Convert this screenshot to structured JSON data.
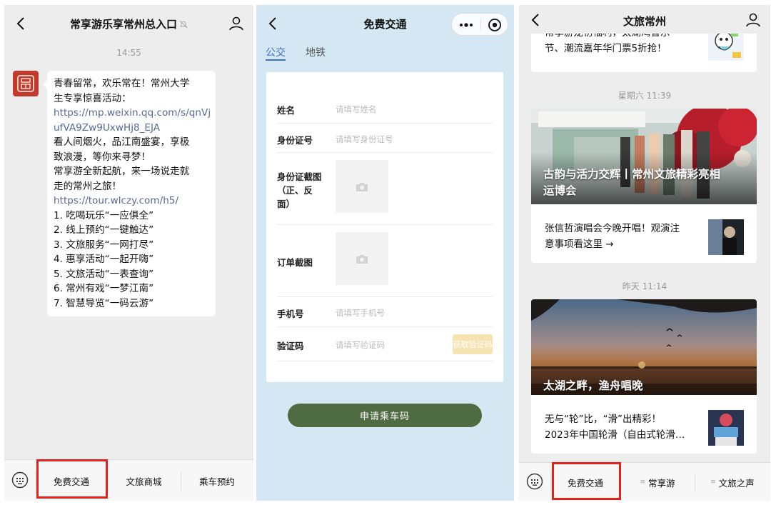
{
  "chat": {
    "title": "常享游乐享常州总入口",
    "time": "14:55",
    "message_lines": [
      "青春留常，欢乐常在！常州大学",
      "生专享惊喜活动：",
      "https://mp.weixin.qq.com/s/qnVj",
      "ufVA9Zw9UxwHj8_EJA",
      "看人间烟火，品江南盛宴，享极",
      "致浪漫，等你来寻梦！",
      "常享游全新起航，来一场说走就",
      "走的常州之旅！",
      "https://tour.wlczy.com/h5/",
      "1. 吃喝玩乐“一应俱全”",
      "2. 线上预约“一键触达”",
      "3. 文旅服务“一网打尽”",
      "4. 惠享活动“一起开嗨”",
      "5. 文旅活动“一表查询”",
      "6. 常州有戏“一梦江南”",
      "7. 智慧导览“一码云游”"
    ],
    "menu": [
      "免费交通",
      "文旅商城",
      "乘车预约"
    ]
  },
  "transit": {
    "title": "免费交通",
    "tabs": [
      "公交",
      "地铁"
    ],
    "fields": {
      "name_label": "姓名",
      "name_placeholder": "请填写姓名",
      "id_label": "身份证号",
      "id_placeholder": "请填写身份证号",
      "id_photo_label_1": "身份证截图",
      "id_photo_label_2": "（正、反",
      "id_photo_label_3": "面）",
      "order_label": "订单截图",
      "phone_label": "手机号",
      "phone_placeholder": "请填写手机号",
      "code_label": "验证码",
      "code_placeholder": "请填写验证码",
      "code_button": "获取验证码"
    },
    "apply_button": "申请乘车码"
  },
  "account": {
    "title": "文旅常州",
    "partial_top_1": "常享游龙初福利，太湖湾音乐",
    "partial_top_2": "节、潮流嘉年华门票5折抢！",
    "stamp_1": "星期六 11:39",
    "hero_1_line1": "古韵与活力交辉丨常州文旅精彩亮相",
    "hero_1_line2": "运博会",
    "article_1_line1": "张信哲演唱会今晚开唱！观演注",
    "article_1_line2": "意事项看这里 →",
    "stamp_2": "昨天 11:14",
    "hero_2_line1": "太湖之畔，渔舟唱晚",
    "article_2_line1": "无与“轮”比，“滑”出精彩！",
    "article_2_line2": "2023年中国轮滑（自由式轮滑…",
    "menu": [
      "免费交通",
      "常享游",
      "文旅之声"
    ]
  },
  "colors": {
    "highlight_box": "#e0231c",
    "link": "#576b95",
    "tab_active": "#3f6fc4",
    "apply_button": "#4f6b42",
    "code_button": "#f6e3b2"
  },
  "icons": [
    "back-icon",
    "mute-bell-icon",
    "person-icon",
    "more-dots-icon",
    "target-icon",
    "keyboard-icon",
    "camera-icon",
    "menu-list-icon"
  ]
}
